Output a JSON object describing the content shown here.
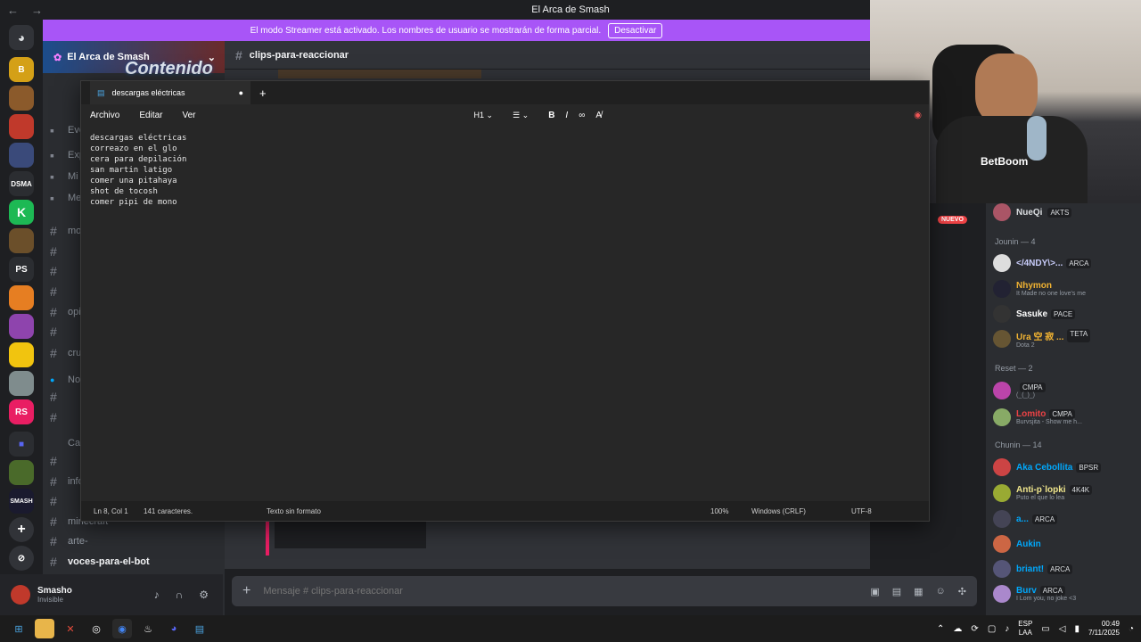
{
  "window_title": "El Arca de Smash",
  "banner": {
    "text": "El modo Streamer está activado. Los nombres de usuario se mostrarán de forma parcial.",
    "button": "Desactivar"
  },
  "server": {
    "name": "El Arca de Smash",
    "banner_text": "Contenido"
  },
  "channels": [
    {
      "label": "Eve",
      "icon": "calendar-icon"
    },
    {
      "label": "Exp",
      "icon": "compass-icon"
    },
    {
      "label": "Mi",
      "icon": "grid-icon"
    },
    {
      "label": "Me",
      "icon": "people-icon"
    },
    {
      "label": "mo",
      "icon": "hash"
    },
    {
      "label": "",
      "icon": "hash"
    },
    {
      "label": "",
      "icon": "hash"
    },
    {
      "label": "",
      "icon": "hash"
    },
    {
      "label": "opi",
      "icon": "hash"
    },
    {
      "label": "",
      "icon": "hash"
    },
    {
      "label": "cru",
      "icon": "hash"
    },
    {
      "label": "Noti",
      "icon": "dot"
    },
    {
      "label": "",
      "icon": "hash"
    },
    {
      "label": "",
      "icon": "hash"
    },
    {
      "label": "Canales",
      "icon": ""
    },
    {
      "label": "",
      "icon": "hash"
    },
    {
      "label": "info",
      "icon": "hash"
    },
    {
      "label": "",
      "icon": "hash"
    },
    {
      "label": "minecraft",
      "icon": "hash"
    },
    {
      "label": "arte-",
      "icon": "hash"
    },
    {
      "label": "voces-para-el-bot",
      "icon": "hash"
    }
  ],
  "chat": {
    "channel": "clips-para-reaccionar",
    "placeholder": "Mensaje # clips-para-reaccionar",
    "new_badge": "NUEVO"
  },
  "user": {
    "name": "Smasho",
    "status": "Invisible"
  },
  "members": {
    "top": {
      "name": "NueQi",
      "tag": "AKTS"
    },
    "groups": [
      {
        "label": "Jounin — 4",
        "items": [
          {
            "name": "</4NDY\\>...",
            "tag": "ARCA",
            "status": "",
            "color": "#c9cdfb"
          },
          {
            "name": "Nhymon",
            "tag": "",
            "status": "It Made no one love's me",
            "color": "#f0b232"
          },
          {
            "name": "Sasuke",
            "tag": "PACE",
            "status": "",
            "color": "#ffffff"
          },
          {
            "name": "Ura 空 寂 ...",
            "tag": "TETA",
            "status": "Dota 2",
            "color": "#f0b232"
          }
        ]
      },
      {
        "label": "Reset — 2",
        "items": [
          {
            "name": "",
            "tag": "CMPA",
            "status": "(_(_)_)",
            "color": "#ed4245"
          },
          {
            "name": "Lomito",
            "tag": "CMPA",
            "status": "Burvsjita - Show me h...",
            "color": "#ed4245"
          }
        ]
      },
      {
        "label": "Chunin — 14",
        "items": [
          {
            "name": "Aka Cebollita",
            "tag": "BPSR",
            "status": "",
            "color": "#00a8fc"
          },
          {
            "name": "Anti-p`lopki",
            "tag": "4K4K",
            "status": "Puto el que lo lea",
            "color": "#f0e68c"
          },
          {
            "name": "a...",
            "tag": "ARCA",
            "status": "",
            "color": "#00a8fc"
          },
          {
            "name": "Aukin",
            "tag": "",
            "status": "",
            "color": "#00a8fc"
          },
          {
            "name": "briant!",
            "tag": "ARCA",
            "status": "",
            "color": "#00a8fc"
          },
          {
            "name": "Burv",
            "tag": "ARCA",
            "status": "I Lom you, no joke <3",
            "color": "#00a8fc"
          }
        ]
      }
    ]
  },
  "notepad": {
    "tab": "descargas eléctricas",
    "menu": [
      "Archivo",
      "Editar",
      "Ver"
    ],
    "heading_select": "H1",
    "lines": [
      "descargas eléctricas",
      "correazo en el glo",
      "cera para depilación",
      "san martin latigo",
      "comer una pitahaya",
      "shot de tocosh",
      "comer pipi de mono"
    ],
    "status": {
      "position": "Ln 8, Col 1",
      "chars": "141 caracteres.",
      "format": "Texto sin formato",
      "zoom": "100%",
      "eol": "Windows (CRLF)",
      "encoding": "UTF-8"
    }
  },
  "taskbar": {
    "lang": "ESP",
    "lang2": "LAA",
    "time": "00:49",
    "date": "7/11/2025"
  },
  "colors": {
    "banner": "#a855f7",
    "discord_bg": "#313338",
    "sidebar": "#2b2d31"
  }
}
